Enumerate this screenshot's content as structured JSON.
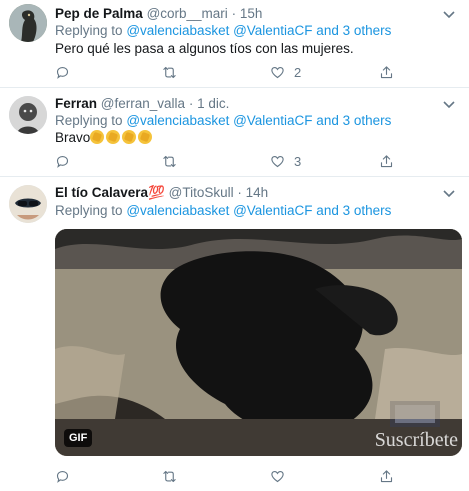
{
  "tweets": [
    {
      "name": "Pep de Palma",
      "handle": "@corb__mari",
      "sep": "·",
      "time": "15h",
      "replying_prefix": "Replying to",
      "mentions": "@valenciabasket @ValentiaCF and 3 others",
      "text": "Pero qué les pasa a algunos tíos con las mujeres.",
      "replies": "",
      "retweets": "",
      "likes": "2"
    },
    {
      "name": "Ferran",
      "handle": "@ferran_valla",
      "sep": "·",
      "time": "1 dic.",
      "replying_prefix": "Replying to",
      "mentions": "@valenciabasket @ValentiaCF and 3 others",
      "text": "Bravo",
      "emoji": [
        "clapping-hands-emoji",
        "clapping-hands-emoji",
        "clapping-hands-emoji",
        "clapping-hands-emoji"
      ],
      "replies": "",
      "retweets": "",
      "likes": "3"
    },
    {
      "name": "El tío Calavera💯",
      "handle": "@TitoSkull",
      "sep": "·",
      "time": "14h",
      "replying_prefix": "Replying to",
      "mentions": "@valenciabasket @ValentiaCF and 3 others",
      "gif_badge": "GIF",
      "gif_overlay_text": "Suscríbete",
      "replies": "",
      "retweets": "",
      "likes": ""
    }
  ],
  "icons": {
    "reply": "reply-icon",
    "retweet": "retweet-icon",
    "like": "heart-icon",
    "share": "share-icon",
    "more": "chevron-down-icon"
  },
  "colors": {
    "link": "#1b95e0",
    "muted": "#657786",
    "divider": "#e6ecf0"
  }
}
